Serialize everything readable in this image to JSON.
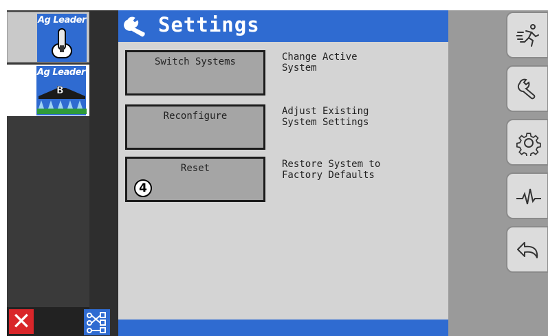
{
  "systems": [
    {
      "brand": "Ag Leader",
      "icon": "joystick-icon"
    },
    {
      "brand": "Ag Leader",
      "badge": "B",
      "icon": "sprayer-boom-icon"
    }
  ],
  "header": {
    "title": "Settings",
    "icon": "wrench-icon"
  },
  "options": [
    {
      "label": "Switch Systems",
      "description": "Change Active\nSystem"
    },
    {
      "label": "Reconfigure",
      "description": "Adjust Existing\nSystem Settings"
    },
    {
      "label": "Reset",
      "description": "Restore System to\nFactory Defaults",
      "callout": "4"
    }
  ],
  "footer": {
    "close_label": "✕"
  },
  "right_toolbar": [
    "running-person-icon",
    "wrench-icon",
    "gear-icon",
    "heartbeat-icon",
    "undo-arrow-icon"
  ],
  "colors": {
    "accent": "#2f6bd1",
    "close": "#d9262a",
    "panel": "#d4d4d4",
    "button": "#a5a5a5"
  }
}
